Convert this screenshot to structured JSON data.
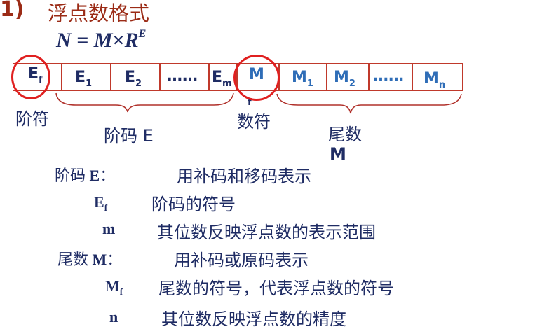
{
  "heading": {
    "number": "1)",
    "title": "浮点数格式"
  },
  "formula": {
    "lhs": "N",
    "eq": " = ",
    "m": "M",
    "times": "×",
    "r": "R",
    "exp": "E"
  },
  "register": {
    "exponent_cells": [
      {
        "main": "E",
        "sub": "f"
      },
      {
        "main": "E",
        "sub": "1"
      },
      {
        "main": "E",
        "sub": "2"
      },
      {
        "main": "……",
        "sub": ""
      },
      {
        "main": "E",
        "sub": "m"
      }
    ],
    "mantissa_cells": [
      {
        "main": "M",
        "sub": "f"
      },
      {
        "main": "M",
        "sub": "1"
      },
      {
        "main": "M",
        "sub": "2"
      },
      {
        "main": "……",
        "sub": ""
      },
      {
        "main": "M",
        "sub": "n"
      }
    ]
  },
  "labels": {
    "exp_sign": "阶符",
    "exponent": "阶码 E",
    "num_sign": "数符",
    "mantissa_line1": "尾数",
    "mantissa_line2": "M"
  },
  "descriptions": [
    {
      "term_cn": "阶码",
      "term_latin": " E",
      "term_sub": "",
      "colon": "：",
      "text": "用补码和移码表示"
    },
    {
      "term_cn": "",
      "term_latin": "E",
      "term_sub": "f",
      "colon": "",
      "text": "阶码的符号"
    },
    {
      "term_cn": "",
      "term_latin": "m",
      "term_sub": "",
      "colon": "",
      "text": "其位数反映浮点数的表示范围"
    },
    {
      "term_cn": "尾数",
      "term_latin": " M",
      "term_sub": "",
      "colon": "：",
      "text": "用补码或原码表示"
    },
    {
      "term_cn": "",
      "term_latin": "M",
      "term_sub": "f",
      "colon": "",
      "text": "尾数的符号，代表浮点数的符号"
    },
    {
      "term_cn": "",
      "term_latin": "n",
      "term_sub": "",
      "colon": "",
      "text": "其位数反映浮点数的精度"
    }
  ],
  "colors": {
    "heading": "#9b2b16",
    "dark_navy": "#1f2c64",
    "mantissa_blue": "#2f6db7",
    "box_border": "#c0392b",
    "circle": "#e02020"
  }
}
